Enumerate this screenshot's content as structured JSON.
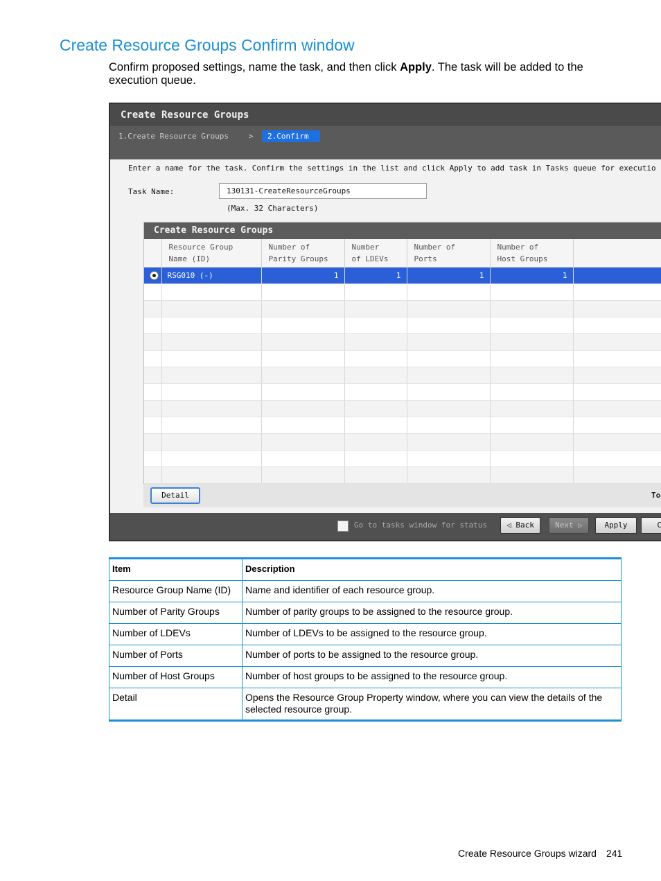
{
  "heading": "Create Resource Groups Confirm window",
  "intro": {
    "before": "Confirm proposed settings, name the task, and then click ",
    "bold": "Apply",
    "after": ". The task will be added to the execution queue."
  },
  "screenshot": {
    "title": "Create Resource Groups",
    "steps": {
      "step1": "1.Create Resource Groups",
      "separator": ">",
      "step2": "2.Confirm"
    },
    "instruction": "Enter a name for the task. Confirm the settings in the list and click Apply to add task in Tasks queue for executio",
    "task_name_label": "Task Name:",
    "task_name_value": "130131-CreateResourceGroups",
    "task_name_hint": "(Max. 32 Characters)",
    "grid": {
      "title": "Create Resource Groups",
      "columns": [
        {
          "l1": "Resource Group",
          "l2": "Name (ID)"
        },
        {
          "l1": "Number of",
          "l2": "Parity Groups"
        },
        {
          "l1": "Number",
          "l2": "of LDEVs"
        },
        {
          "l1": "Number of",
          "l2": "Ports"
        },
        {
          "l1": "Number of",
          "l2": "Host Groups"
        }
      ],
      "row": {
        "name": "RSG010 (-)",
        "parity_groups": "1",
        "ldevs": "1",
        "ports": "1",
        "host_groups": "1"
      }
    },
    "detail_button": "Detail",
    "footer_right": "To",
    "go_to_tasks_label": "Go to tasks window for status",
    "buttons": {
      "back": "◁ Back",
      "next": "Next ▷",
      "apply": "Apply",
      "cancel": "Ca"
    }
  },
  "table": {
    "headers": [
      "Item",
      "Description"
    ],
    "rows": [
      [
        "Resource Group Name (ID)",
        "Name and identifier of each resource group."
      ],
      [
        "Number of Parity Groups",
        "Number of parity groups to be assigned to the resource group."
      ],
      [
        "Number of LDEVs",
        "Number of LDEVs to be assigned to the resource group."
      ],
      [
        "Number of Ports",
        "Number of ports to be assigned to the resource group."
      ],
      [
        "Number of Host Groups",
        "Number of host groups to be assigned to the resource group."
      ],
      [
        "Detail",
        "Opens the Resource Group Property window, where you can view the details of the selected resource group."
      ]
    ]
  },
  "footer": {
    "section": "Create Resource Groups wizard",
    "page": "241"
  },
  "colors": {
    "accent": "#1a8fd6",
    "selection": "#2a5fd8",
    "step_active": "#1e6fe0"
  }
}
